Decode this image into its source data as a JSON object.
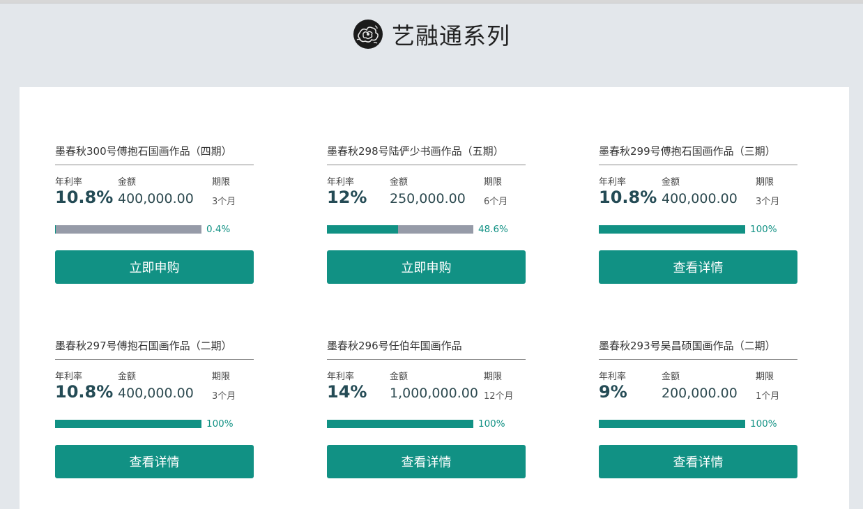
{
  "header": {
    "title": "艺融通系列",
    "logo_icon": "ink-cloud-logo-icon"
  },
  "labels": {
    "rate": "年利率",
    "amount": "金额",
    "term": "期限"
  },
  "colors": {
    "accent": "#119184",
    "bar_bg": "#969ba8",
    "page_bg": "#e3e7eb"
  },
  "products": [
    {
      "title": "墨春秋300号傅抱石国画作品（四期）",
      "rate": "10.8%",
      "amount": "400,000.00",
      "term": "3个月",
      "progress": 0.004,
      "progress_text": "0.4%",
      "button": "立即申购"
    },
    {
      "title": "墨春秋298号陆俨少书画作品（五期）",
      "rate": "12%",
      "amount": "250,000.00",
      "term": "6个月",
      "progress": 0.486,
      "progress_text": "48.6%",
      "button": "立即申购"
    },
    {
      "title": "墨春秋299号傅抱石国画作品（三期）",
      "rate": "10.8%",
      "amount": "400,000.00",
      "term": "3个月",
      "progress": 1.0,
      "progress_text": "100%",
      "button": "查看详情"
    },
    {
      "title": "墨春秋297号傅抱石国画作品（二期）",
      "rate": "10.8%",
      "amount": "400,000.00",
      "term": "3个月",
      "progress": 1.0,
      "progress_text": "100%",
      "button": "查看详情"
    },
    {
      "title": "墨春秋296号任伯年国画作品",
      "rate": "14%",
      "amount": "1,000,000.00",
      "term": "12个月",
      "progress": 1.0,
      "progress_text": "100%",
      "button": "查看详情"
    },
    {
      "title": "墨春秋293号吴昌硕国画作品（二期）",
      "rate": "9%",
      "amount": "200,000.00",
      "term": "1个月",
      "progress": 1.0,
      "progress_text": "100%",
      "button": "查看详情"
    }
  ]
}
